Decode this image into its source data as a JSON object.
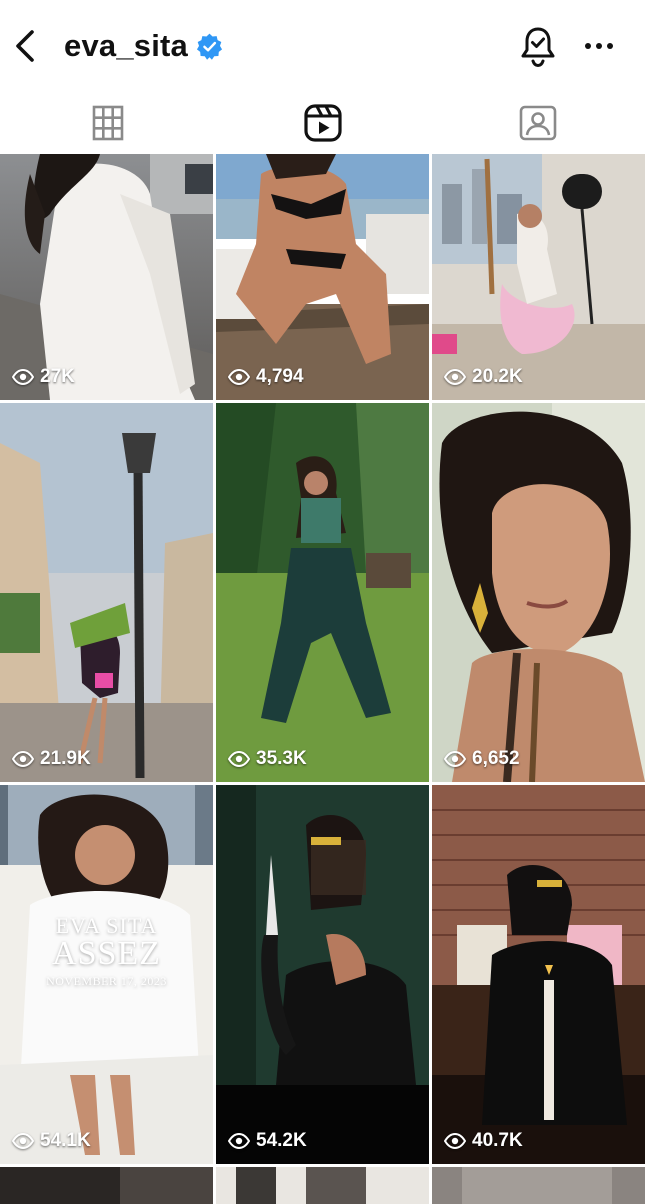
{
  "header": {
    "username": "eva_sita",
    "verified": true
  },
  "tabs": [
    {
      "id": "grid",
      "icon": "grid-icon",
      "active": false
    },
    {
      "id": "reels",
      "icon": "reels-icon",
      "active": true
    },
    {
      "id": "tagged",
      "icon": "tagged-icon",
      "active": false
    }
  ],
  "reels": [
    {
      "views": "27K"
    },
    {
      "views": "4,794"
    },
    {
      "views": "20.2K"
    },
    {
      "views": "21.9K"
    },
    {
      "views": "35.3K"
    },
    {
      "views": "6,652"
    },
    {
      "views": "54.1K",
      "overlay": {
        "line1": "EVA SITA",
        "line2": "ASSEZ",
        "line3": "NOVEMBER 17, 2023"
      }
    },
    {
      "views": "54.2K"
    },
    {
      "views": "40.7K"
    }
  ],
  "colors": {
    "verified_blue": "#2f97f5",
    "icon_dark": "#262626",
    "text_white": "#ffffff"
  }
}
